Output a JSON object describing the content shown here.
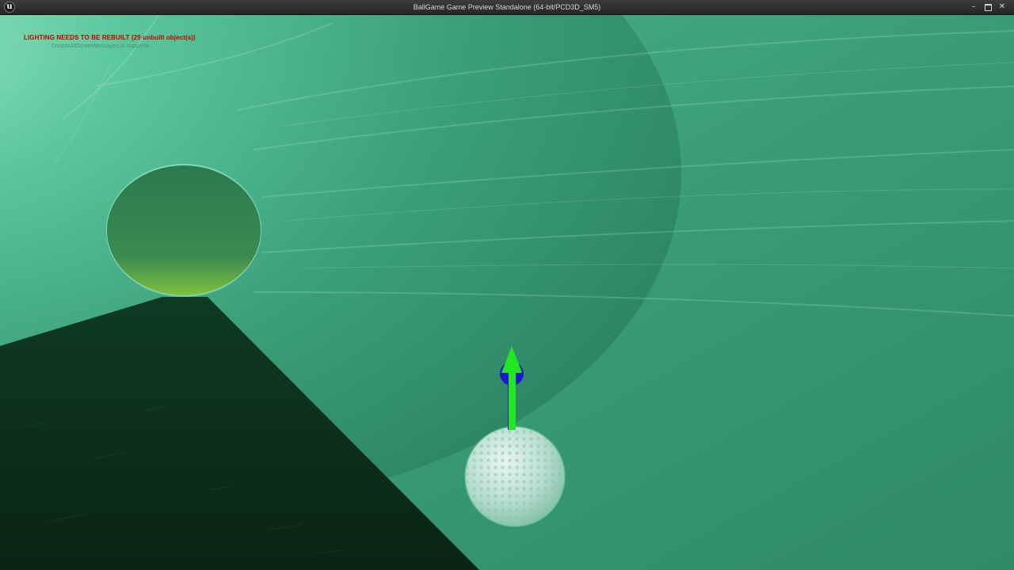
{
  "window": {
    "title": "BallGame Game Preview Standalone (64-bit/PCD3D_SM5)",
    "logo_glyph": "u",
    "logo_icon": "unreal-engine-logo-icon",
    "controls": {
      "minimize": "–",
      "maximize_icon": "maximize-icon",
      "close": "✕"
    }
  },
  "hud": {
    "warning_text": "LIGHTING NEEDS TO BE REBUILT (29 unbuilt object(s))",
    "warning_color": "#c80000",
    "sub_text": "DisableAllScreenMessages to suppress"
  },
  "scene": {
    "fog_color": "#2f8a66",
    "tunnel_highlight": "#8fe7c2",
    "floor_color": "#0e2a1a",
    "ball_color": "#cfe8df",
    "arrow_color": "#22e622",
    "sphere_marker_color": "#1a1acc"
  }
}
